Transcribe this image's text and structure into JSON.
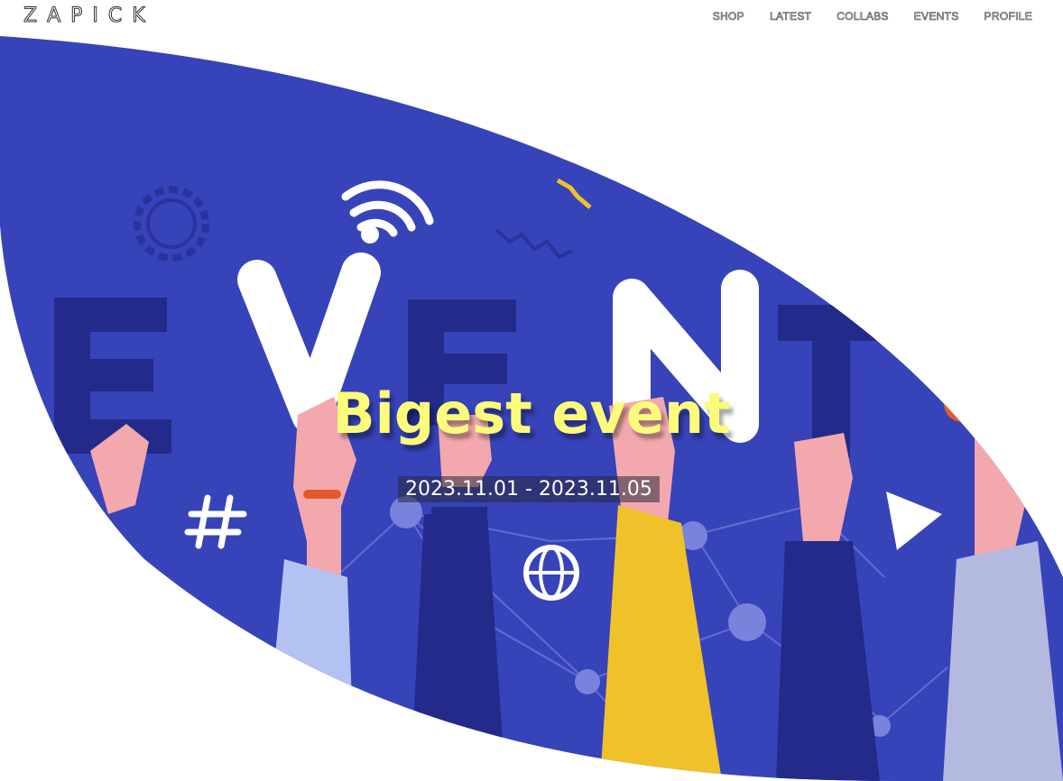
{
  "header": {
    "logo": "ZAPICK",
    "nav": [
      "SHOP",
      "LATEST",
      "COLLABS",
      "EVENTS",
      "PROFILE"
    ]
  },
  "hero": {
    "title": "Bigest event",
    "date_range": "2023.11.01 - 2023.11.05",
    "illustration_letters": "EVENT"
  },
  "colors": {
    "hero_bg": "#3743b9",
    "title": "#fdfb7a",
    "accent_yellow": "#f0c22a",
    "accent_orange": "#e4582f",
    "navy": "#232a8a",
    "skin": "#f3a8ae"
  }
}
